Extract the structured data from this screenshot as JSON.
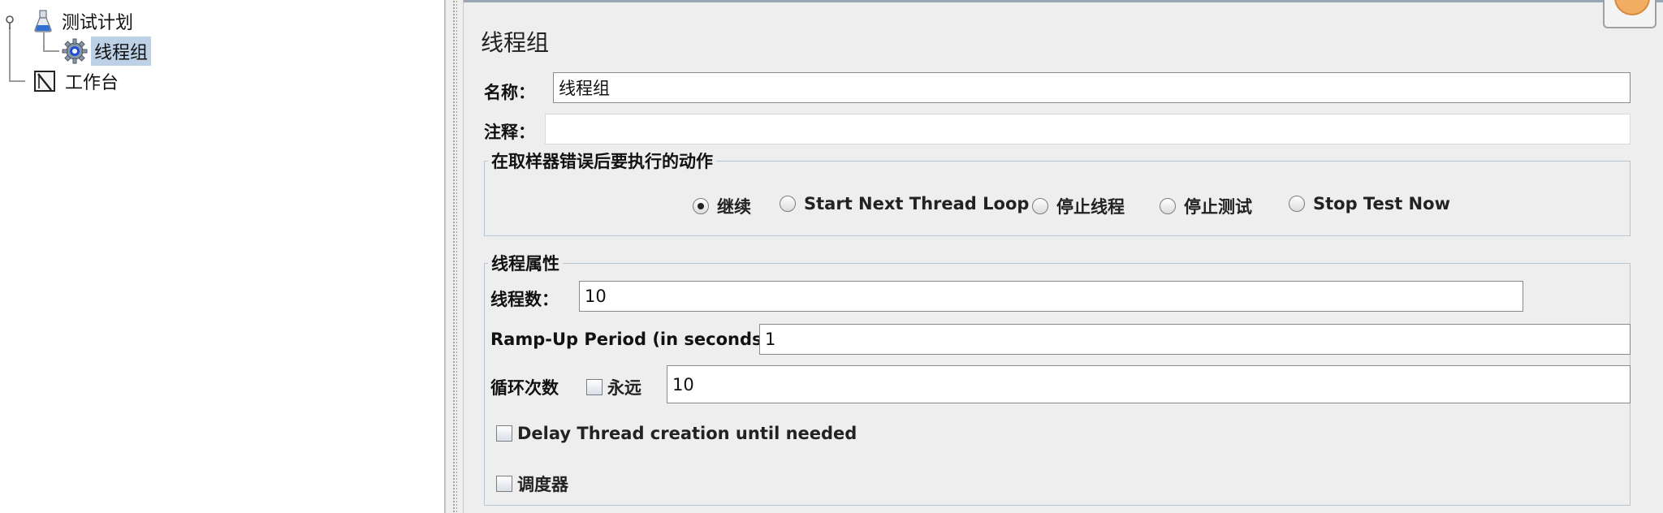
{
  "tree": {
    "items": [
      {
        "label": "测试计划",
        "icon": "test-plan-flask-icon"
      },
      {
        "label": "线程组",
        "icon": "gear-icon",
        "selected": true
      },
      {
        "label": "工作台",
        "icon": "workbench-icon"
      }
    ]
  },
  "panel": {
    "title": "线程组",
    "name_label": "名称：",
    "name_value": "线程组",
    "comment_label": "注释：",
    "comment_value": ""
  },
  "error_action": {
    "legend": "在取样器错误后要执行的动作",
    "options": [
      {
        "label": "继续",
        "selected": true
      },
      {
        "label": "Start Next Thread Loop",
        "selected": false
      },
      {
        "label": "停止线程",
        "selected": false
      },
      {
        "label": "停止测试",
        "selected": false
      },
      {
        "label": "Stop Test Now",
        "selected": false
      }
    ]
  },
  "thread_props": {
    "legend": "线程属性",
    "threads_label": "线程数：",
    "threads_value": "10",
    "rampup_label": "Ramp-Up Period (in seconds):",
    "rampup_value": "1",
    "loop_label": "循环次数",
    "forever_label": "永远",
    "forever_checked": false,
    "loop_value": "10",
    "delay_label": "Delay Thread creation until needed",
    "delay_checked": false,
    "scheduler_label": "调度器",
    "scheduler_checked": false
  },
  "colors": {
    "selection": "#bcd0e6",
    "group_border": "#b7c6d6",
    "background": "#eeeeee"
  }
}
